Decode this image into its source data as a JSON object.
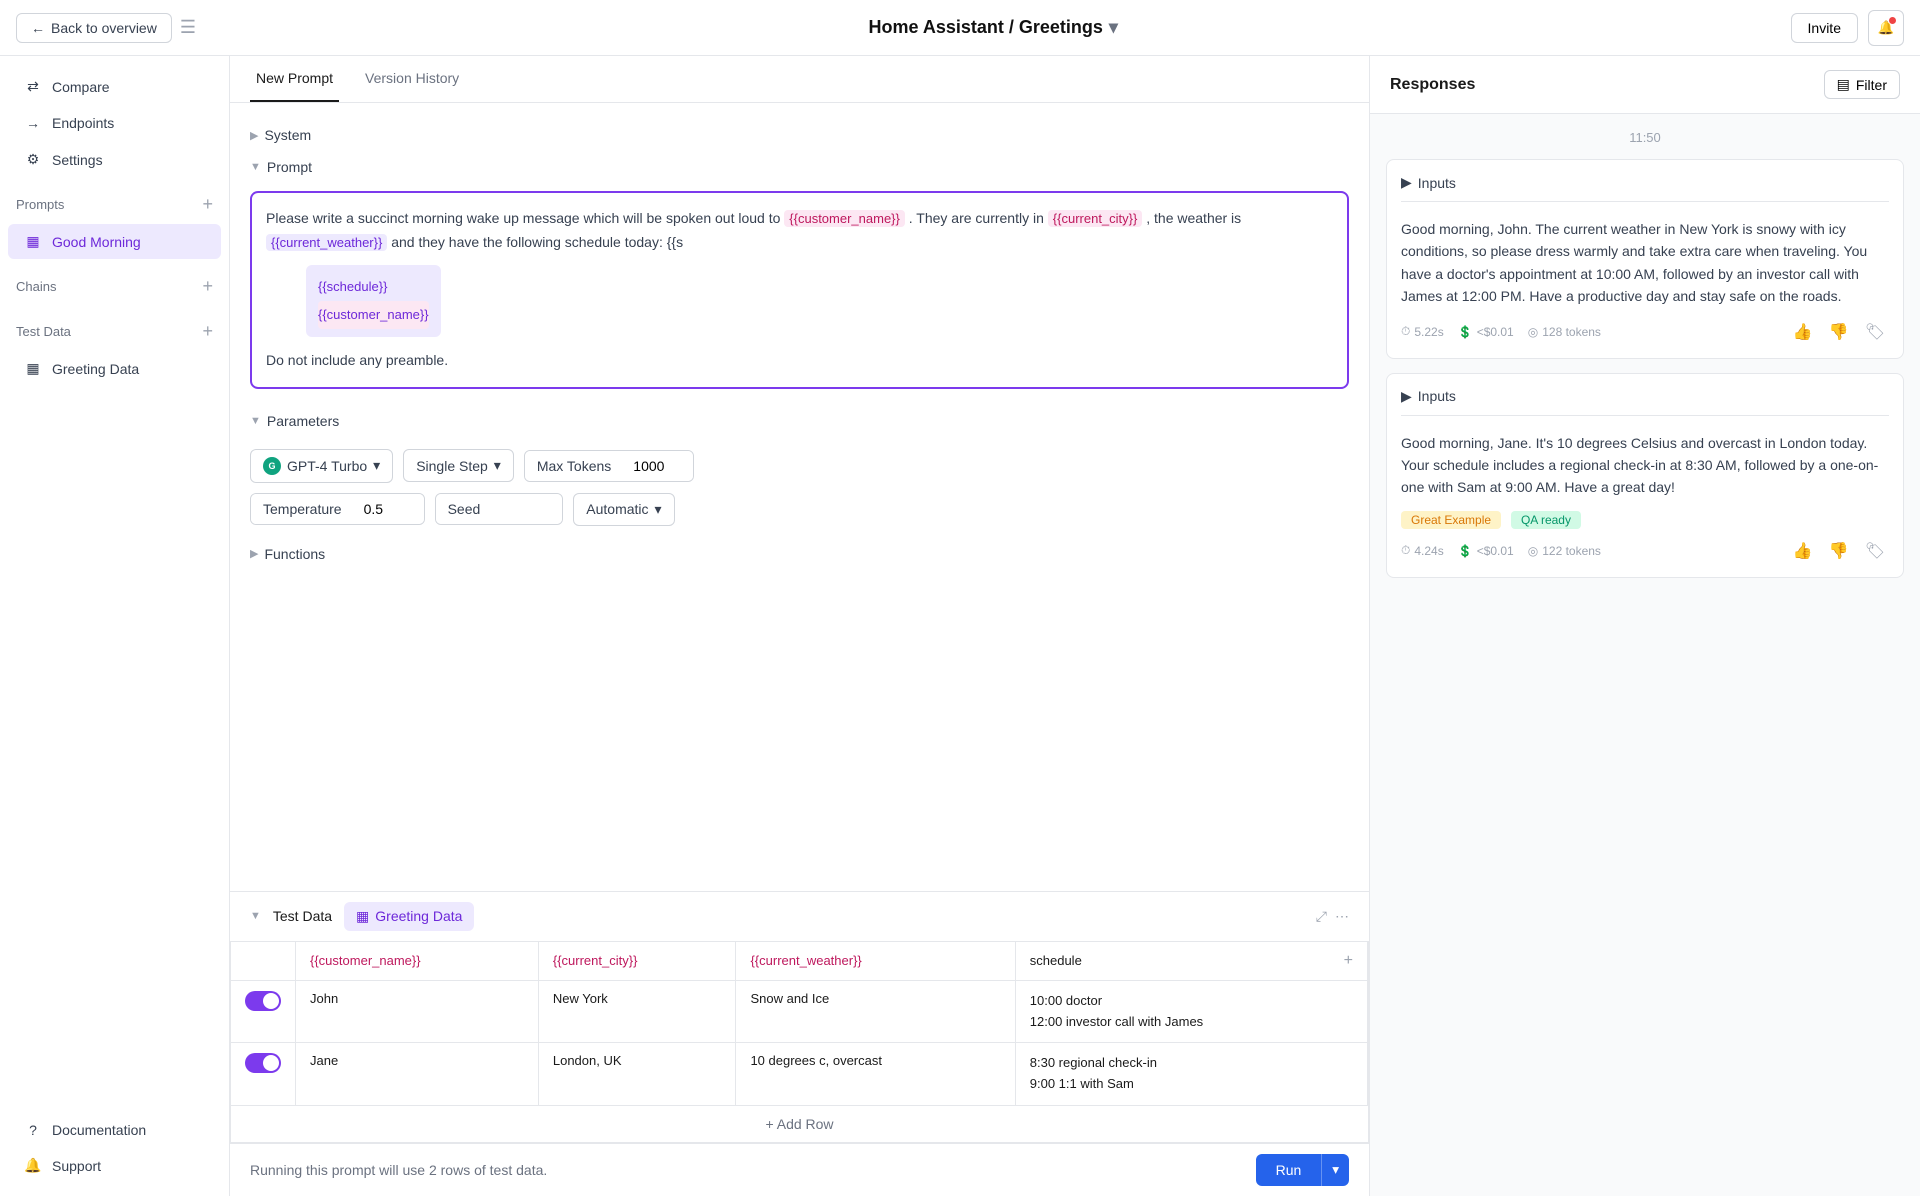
{
  "header": {
    "back_label": "Back to overview",
    "title": "Home Assistant / Greetings",
    "invite_label": "Invite",
    "chevron": "▾"
  },
  "sidebar": {
    "nav_items": [
      {
        "label": "Compare",
        "icon": "⇄",
        "active": false
      },
      {
        "label": "Endpoints",
        "icon": "→",
        "active": false
      },
      {
        "label": "Settings",
        "icon": "⚙",
        "active": false
      }
    ],
    "sections": [
      {
        "title": "Prompts",
        "items": [
          {
            "label": "Good Morning",
            "icon": "▦",
            "active": true
          }
        ]
      },
      {
        "title": "Chains",
        "items": []
      },
      {
        "title": "Test Data",
        "items": [
          {
            "label": "Greeting Data",
            "icon": "▦",
            "active": false
          }
        ]
      }
    ],
    "bottom_items": [
      {
        "label": "Documentation",
        "icon": "?"
      },
      {
        "label": "Support",
        "icon": "🔔"
      }
    ]
  },
  "center": {
    "tabs": [
      {
        "label": "New Prompt",
        "active": true
      },
      {
        "label": "Version History",
        "active": false
      }
    ],
    "system_label": "System",
    "prompt_label": "Prompt",
    "prompt_text_pre": "Please write a succinct morning wake up message which will be spoken out loud to ",
    "tag1": "{{customer_name}}",
    "prompt_text_mid1": ". They are currently in ",
    "tag2": "{{current_city}}",
    "prompt_text_mid2": ", the weather is ",
    "tag3": "{{current_weather}}",
    "prompt_text_mid3": " and they have the following schedule today: {{s",
    "autocomplete_items": [
      "{{schedule}}",
      "{{customer_name}}"
    ],
    "prompt_text_end": "Do not include any preamble.",
    "params_label": "Parameters",
    "model_label": "GPT-4 Turbo",
    "step_label": "Single Step",
    "max_tokens_label": "Max Tokens",
    "max_tokens_value": "1000",
    "temperature_label": "Temperature",
    "temperature_value": "0.5",
    "seed_label": "Seed",
    "seed_value": "",
    "automatic_label": "Automatic",
    "functions_label": "Functions"
  },
  "test_data": {
    "section_label": "Test Data",
    "tab_label": "Greeting Data",
    "columns": [
      "",
      "{{customer_name}}",
      "{{current_city}}",
      "{{current_weather}}",
      "schedule"
    ],
    "rows": [
      {
        "toggle": true,
        "customer_name": "John",
        "current_city": "New York",
        "current_weather": "Snow and Ice",
        "schedule": "10:00 doctor\n12:00 investor call with James"
      },
      {
        "toggle": true,
        "customer_name": "Jane",
        "current_city": "London, UK",
        "current_weather": "10 degrees c, overcast",
        "schedule": "8:30 regional check-in\n9:00 1:1 with Sam"
      }
    ],
    "add_row_label": "+ Add Row"
  },
  "bottom_bar": {
    "info_text": "Running this prompt will use 2 rows of test data.",
    "run_label": "Run"
  },
  "responses": {
    "title": "Responses",
    "filter_label": "Filter",
    "time_label": "11:50",
    "cards": [
      {
        "inputs_label": "Inputs",
        "text": "Good morning, John. The current weather in New York is snowy with icy conditions, so please dress warmly and take extra care when traveling. You have a doctor's appointment at 10:00 AM, followed by an investor call with James at 12:00 PM. Have a productive day and stay safe on the roads.",
        "time": "5.22s",
        "cost": "<$0.01",
        "tokens": "128 tokens",
        "tags": []
      },
      {
        "inputs_label": "Inputs",
        "text": "Good morning, Jane. It's 10 degrees Celsius and overcast in London today. Your schedule includes a regional check-in at 8:30 AM, followed by a one-on-one with Sam at 9:00 AM. Have a great day!",
        "time": "4.24s",
        "cost": "<$0.01",
        "tokens": "122 tokens",
        "tags": [
          {
            "label": "Great Example",
            "class": "tag-yellow"
          },
          {
            "label": "QA ready",
            "class": "tag-green"
          }
        ]
      }
    ]
  }
}
